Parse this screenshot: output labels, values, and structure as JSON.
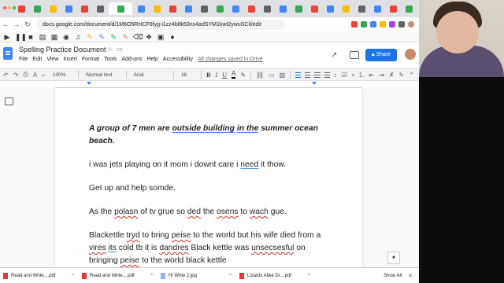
{
  "browser": {
    "url": "docs.google.com/document/d/1M6O5RHCF6fyg-i1zz4b8k53ns4adSYM1kwt2ywuSCil/edit",
    "tab_colors": [
      "#ea4335",
      "#34a853",
      "#fbbc04",
      "#4285f4",
      "#ea4335",
      "#5f6368",
      "#34a853",
      "#4285f4",
      "#fbbc04",
      "#ea4335",
      "#4285f4",
      "#5f6368",
      "#34a853",
      "#4285f4",
      "#ea4335",
      "#5f6368",
      "#4285f4",
      "#34a853",
      "#ea4335",
      "#4285f4",
      "#fbbc04",
      "#5f6368",
      "#4285f4",
      "#ea4335",
      "#34a853"
    ]
  },
  "doc": {
    "title": "Spelling Practice Document",
    "menus": [
      "File",
      "Edit",
      "View",
      "Insert",
      "Format",
      "Tools",
      "Add-ons",
      "Help",
      "Accessibility"
    ],
    "saved_status": "All changes saved in Drive",
    "share_label": "Share"
  },
  "format_toolbar": {
    "zoom": "100%",
    "style": "Normal text",
    "font": "Arial",
    "size": "18"
  },
  "body": {
    "p1_parts": [
      "A group of 7 men are ",
      "outside building",
      " ",
      "in the",
      " summer ocean beach."
    ],
    "p2_a": "i was jets playing on it mom i downt care i ",
    "p2_b": "need",
    "p2_c": " it thow.",
    "p3": "Get up and help somde.",
    "p4_a": "As the ",
    "p4_b": "polasn",
    "p4_c": " of tv grue  so ",
    "p4_d": "ded",
    "p4_e": " the ",
    "p4_f": "osens",
    "p4_g": " to ",
    "p4_h": "wach",
    "p4_i": " gue.",
    "p5_a": "Blackettle ",
    "p5_b": "tryd",
    "p5_c": " to bring ",
    "p5_d": "peise",
    "p5_e": " to the world but his wife died from a ",
    "p5_f": "vires",
    "p5_g": " ",
    "p5_h": "its",
    "p5_i": " cold tb it is ",
    "p5_j": "dandres",
    "p5_k": " Black kettle was ",
    "p5_l": "unsecsesful",
    "p5_m": " on bringing ",
    "p5_n": "peise",
    "p5_o": " to the world black kettle"
  },
  "downloads": {
    "items": [
      "Read and Write....pdf",
      "Read and Write....pdf",
      "Hi Write 2.jpg",
      "Lizards Alike Di....pdf"
    ],
    "show_all": "Show All"
  }
}
